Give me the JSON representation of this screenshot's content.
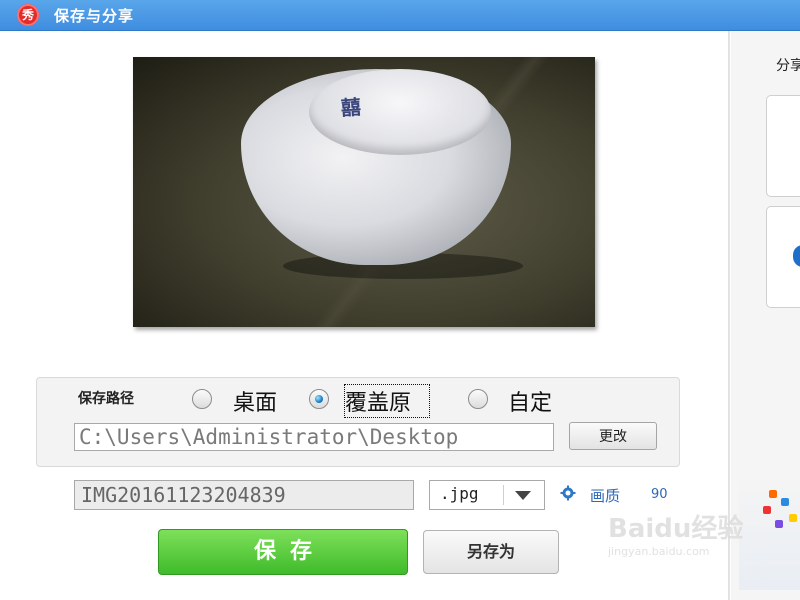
{
  "window": {
    "title": "保存与分享",
    "logo_char": "秀"
  },
  "share": {
    "label": "分享"
  },
  "photo": {
    "description_mark": "囍"
  },
  "save_path": {
    "label": "保存路径",
    "options": [
      {
        "label": "桌面",
        "checked": false
      },
      {
        "label": "覆盖原",
        "checked": true
      },
      {
        "label": "自定",
        "checked": false
      }
    ],
    "path_value": "C:\\Users\\Administrator\\Desktop",
    "change_button": "更改"
  },
  "file": {
    "name": "IMG20161123204839",
    "format": ".jpg",
    "quality_label": "画质",
    "quality_value": "90"
  },
  "actions": {
    "save": "保存",
    "save_as": "另存为"
  },
  "watermark": {
    "main": "Baidu经验",
    "sub": "jingyan.baidu.com"
  },
  "colors": {
    "title_bar": "#4b98e6",
    "save_button": "#4cc634",
    "link": "#2d67b8"
  }
}
